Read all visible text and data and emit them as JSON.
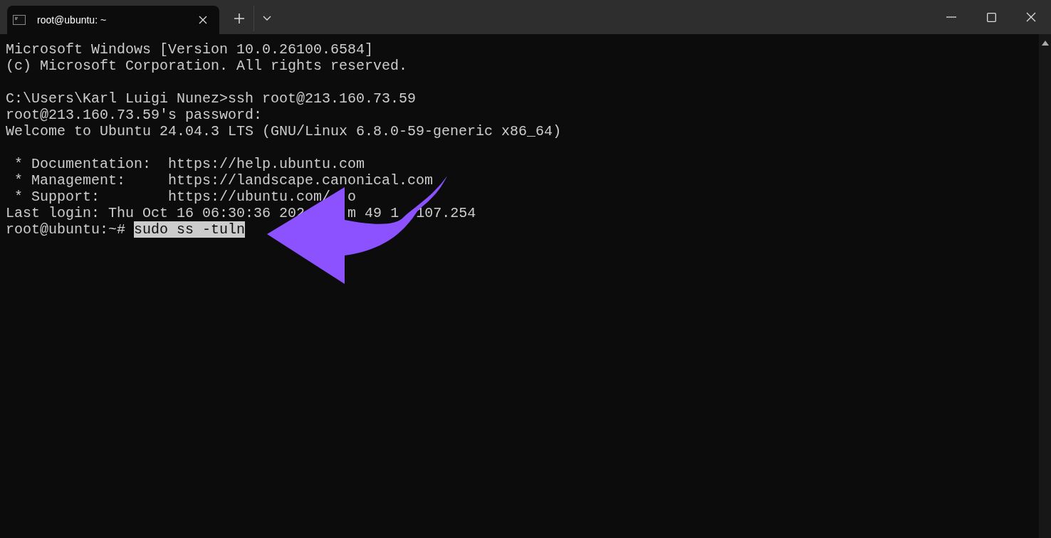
{
  "window": {
    "tab": {
      "title": "root@ubuntu: ~",
      "selected": true
    }
  },
  "terminal": {
    "blocks": [
      {
        "lines": [
          {
            "parts": [
              "Microsoft Windows [Version 10.0.26100.6584]"
            ]
          },
          {
            "parts": [
              "(c) Microsoft Corporation. All rights reserved."
            ]
          }
        ]
      },
      {
        "lines": [
          {
            "parts": [
              "C:\\Users\\Karl Luigi Nunez>ssh root@213.160.73.59"
            ]
          },
          {
            "parts": [
              "root@213.160.73.59's password:"
            ]
          },
          {
            "parts": [
              "Welcome to Ubuntu 24.04.3 LTS (GNU/Linux 6.8.0-59-generic x86_64)"
            ]
          }
        ]
      },
      {
        "lines": [
          {
            "parts": [
              " * Documentation:  https://help.ubuntu.com"
            ]
          },
          {
            "parts": [
              " * Management:     https://landscape.canonical.com"
            ]
          },
          {
            "parts": [
              " * Support:        https://ubuntu.com/",
              "  o"
            ]
          },
          {
            "parts": [
              "Last login: Thu Oct 16 06:30:36 202",
              "     m 49",
              " 1",
              "  107.254"
            ]
          }
        ]
      }
    ],
    "prompt": {
      "text": "root@ubuntu:~# ",
      "command": "sudo ss -tuln",
      "selected": true
    }
  }
}
